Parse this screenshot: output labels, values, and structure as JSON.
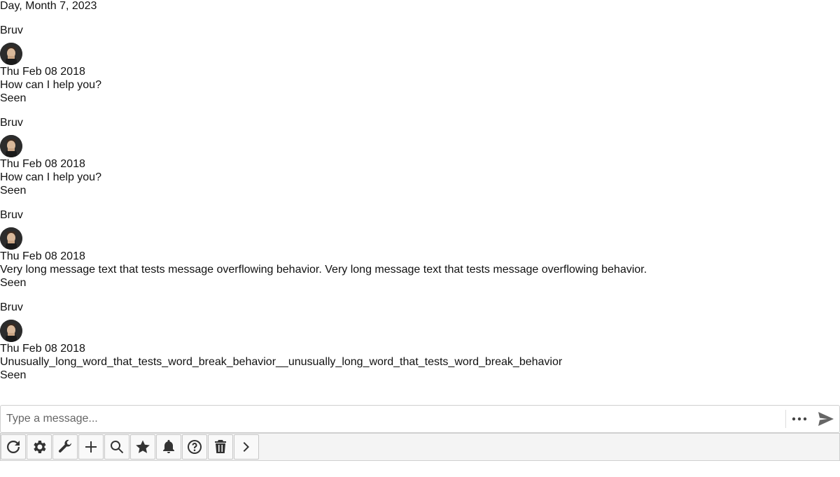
{
  "day_header": "Day, Month 7, 2023",
  "messages": [
    {
      "sender": "Bruv",
      "timestamp": "Thu Feb 08 2018",
      "text": "How can I help you?",
      "status": "Seen"
    },
    {
      "sender": "Bruv",
      "timestamp": "Thu Feb 08 2018",
      "text": "How can I help you?",
      "status": "Seen"
    },
    {
      "sender": "Bruv",
      "timestamp": "Thu Feb 08 2018",
      "text": "Very long message text that tests message overflowing behavior. Very long message text that tests message overflowing behavior.",
      "status": "Seen"
    },
    {
      "sender": "Bruv",
      "timestamp": "Thu Feb 08 2018",
      "text": "Unusually_long_word_that_tests_word_break_behavior__unusually_long_word_that_tests_word_break_behavior",
      "status": "Seen"
    }
  ],
  "composer": {
    "placeholder": "Type a message...",
    "value": "",
    "more_icon": "ellipsis-icon",
    "send_icon": "send-icon"
  },
  "toolbar": {
    "buttons": [
      {
        "icon": "refresh-icon"
      },
      {
        "icon": "gear-icon"
      },
      {
        "icon": "wrench-icon"
      },
      {
        "icon": "plus-icon"
      },
      {
        "icon": "search-icon"
      },
      {
        "icon": "star-icon"
      },
      {
        "icon": "bell-icon"
      },
      {
        "icon": "help-icon"
      },
      {
        "icon": "trash-icon"
      },
      {
        "icon": "chevron-right-icon"
      }
    ]
  }
}
